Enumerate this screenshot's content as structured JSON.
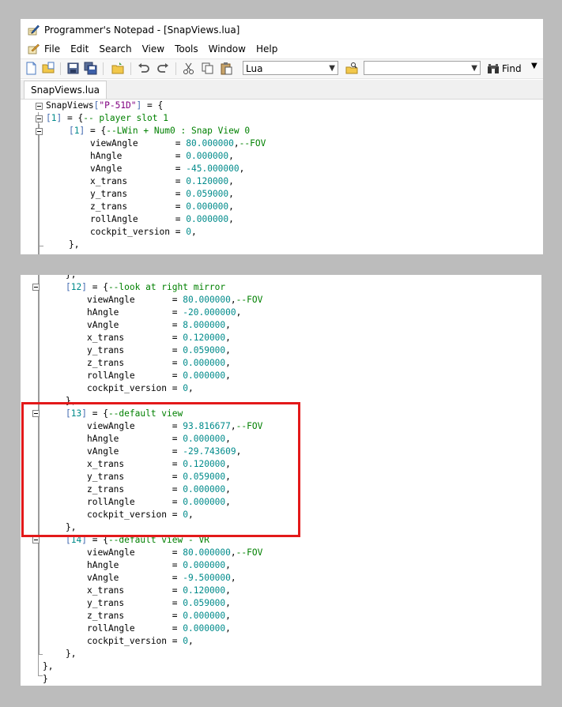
{
  "window": {
    "title": "Programmer's Notepad - [SnapViews.lua]"
  },
  "menu": [
    "File",
    "Edit",
    "Search",
    "View",
    "Tools",
    "Window",
    "Help"
  ],
  "toolbar": {
    "language": "Lua",
    "search_value": "",
    "find_label": "Find"
  },
  "tab": {
    "label": "SnapViews.lua"
  },
  "editor_top": {
    "head": {
      "name": "SnapViews",
      "key": "\"P-51D\""
    },
    "slot": {
      "index": "1",
      "comment": "-- player slot 1"
    },
    "view1": {
      "index": "1",
      "comment": "--LWin + Num0 : Snap View 0"
    },
    "fields": [
      {
        "name": "viewAngle      ",
        "value": "80.000000",
        "comment": "--FOV"
      },
      {
        "name": "hAngle         ",
        "value": "0.000000",
        "comment": ""
      },
      {
        "name": "vAngle         ",
        "value": "-45.000000",
        "comment": ""
      },
      {
        "name": "x_trans        ",
        "value": "0.120000",
        "comment": ""
      },
      {
        "name": "y_trans        ",
        "value": "0.059000",
        "comment": ""
      },
      {
        "name": "z_trans        ",
        "value": "0.000000",
        "comment": ""
      },
      {
        "name": "rollAngle      ",
        "value": "0.000000",
        "comment": ""
      },
      {
        "name": "cockpit_version",
        "value": "0",
        "comment": ""
      }
    ]
  },
  "editor_bottom": {
    "block12": {
      "index": "12",
      "comment": "--look at right mirror",
      "fields": [
        {
          "name": "viewAngle      ",
          "value": "80.000000",
          "comment": "--FOV"
        },
        {
          "name": "hAngle         ",
          "value": "-20.000000",
          "comment": ""
        },
        {
          "name": "vAngle         ",
          "value": "8.000000",
          "comment": ""
        },
        {
          "name": "x_trans        ",
          "value": "0.120000",
          "comment": ""
        },
        {
          "name": "y_trans        ",
          "value": "0.059000",
          "comment": ""
        },
        {
          "name": "z_trans        ",
          "value": "0.000000",
          "comment": ""
        },
        {
          "name": "rollAngle      ",
          "value": "0.000000",
          "comment": ""
        },
        {
          "name": "cockpit_version",
          "value": "0",
          "comment": ""
        }
      ]
    },
    "block13": {
      "index": "13",
      "comment": "--default view",
      "fields": [
        {
          "name": "viewAngle      ",
          "value": "93.816677",
          "comment": "--FOV"
        },
        {
          "name": "hAngle         ",
          "value": "0.000000",
          "comment": ""
        },
        {
          "name": "vAngle         ",
          "value": "-29.743609",
          "comment": ""
        },
        {
          "name": "x_trans        ",
          "value": "0.120000",
          "comment": ""
        },
        {
          "name": "y_trans        ",
          "value": "0.059000",
          "comment": ""
        },
        {
          "name": "z_trans        ",
          "value": "0.000000",
          "comment": ""
        },
        {
          "name": "rollAngle      ",
          "value": "0.000000",
          "comment": ""
        },
        {
          "name": "cockpit_version",
          "value": "0",
          "comment": ""
        }
      ]
    },
    "block14": {
      "index": "14",
      "comment": "--default view - VR",
      "fields": [
        {
          "name": "viewAngle      ",
          "value": "80.000000",
          "comment": "--FOV"
        },
        {
          "name": "hAngle         ",
          "value": "0.000000",
          "comment": ""
        },
        {
          "name": "vAngle         ",
          "value": "-9.500000",
          "comment": ""
        },
        {
          "name": "x_trans        ",
          "value": "0.120000",
          "comment": ""
        },
        {
          "name": "y_trans        ",
          "value": "0.059000",
          "comment": ""
        },
        {
          "name": "z_trans        ",
          "value": "0.000000",
          "comment": ""
        },
        {
          "name": "rollAngle      ",
          "value": "0.000000",
          "comment": ""
        },
        {
          "name": "cockpit_version",
          "value": "0",
          "comment": ""
        }
      ]
    }
  },
  "colors": {
    "number": "#008b8b",
    "string": "#800080",
    "comment": "#008000",
    "highlight": "#e3191a"
  }
}
